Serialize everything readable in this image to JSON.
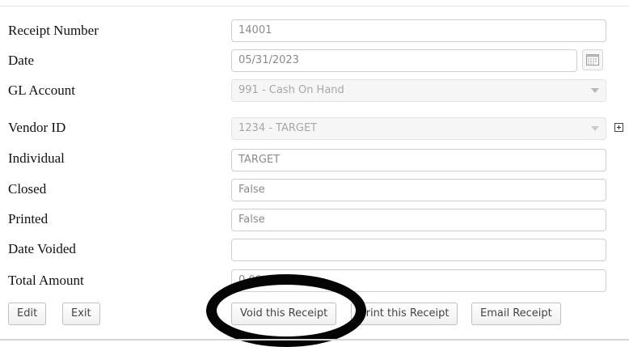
{
  "form": {
    "receipt_number_label": "Receipt Number",
    "receipt_number_value": "14001",
    "date_label": "Date",
    "date_value": "05/31/2023",
    "gl_account_label": "GL Account",
    "gl_account_value": "991 - Cash On Hand",
    "vendor_id_label": "Vendor ID",
    "vendor_id_value": "1234 - TARGET",
    "individual_label": "Individual",
    "individual_value": "TARGET",
    "closed_label": "Closed",
    "closed_value": "False",
    "printed_label": "Printed",
    "printed_value": "False",
    "date_voided_label": "Date Voided",
    "date_voided_value": "",
    "total_amount_label": "Total Amount",
    "total_amount_value": "0.00"
  },
  "buttons": {
    "edit": "Edit",
    "exit": "Exit",
    "void": "Void this Receipt",
    "print": "Print this Receipt",
    "email": "Email Receipt"
  },
  "icons": {
    "calendar": "calendar-icon",
    "dropdown": "chevron-down-icon",
    "expand": "plus-box-icon"
  },
  "colors": {
    "annotation": "#050505",
    "disabled_field_bg": "#f6f6f6"
  }
}
